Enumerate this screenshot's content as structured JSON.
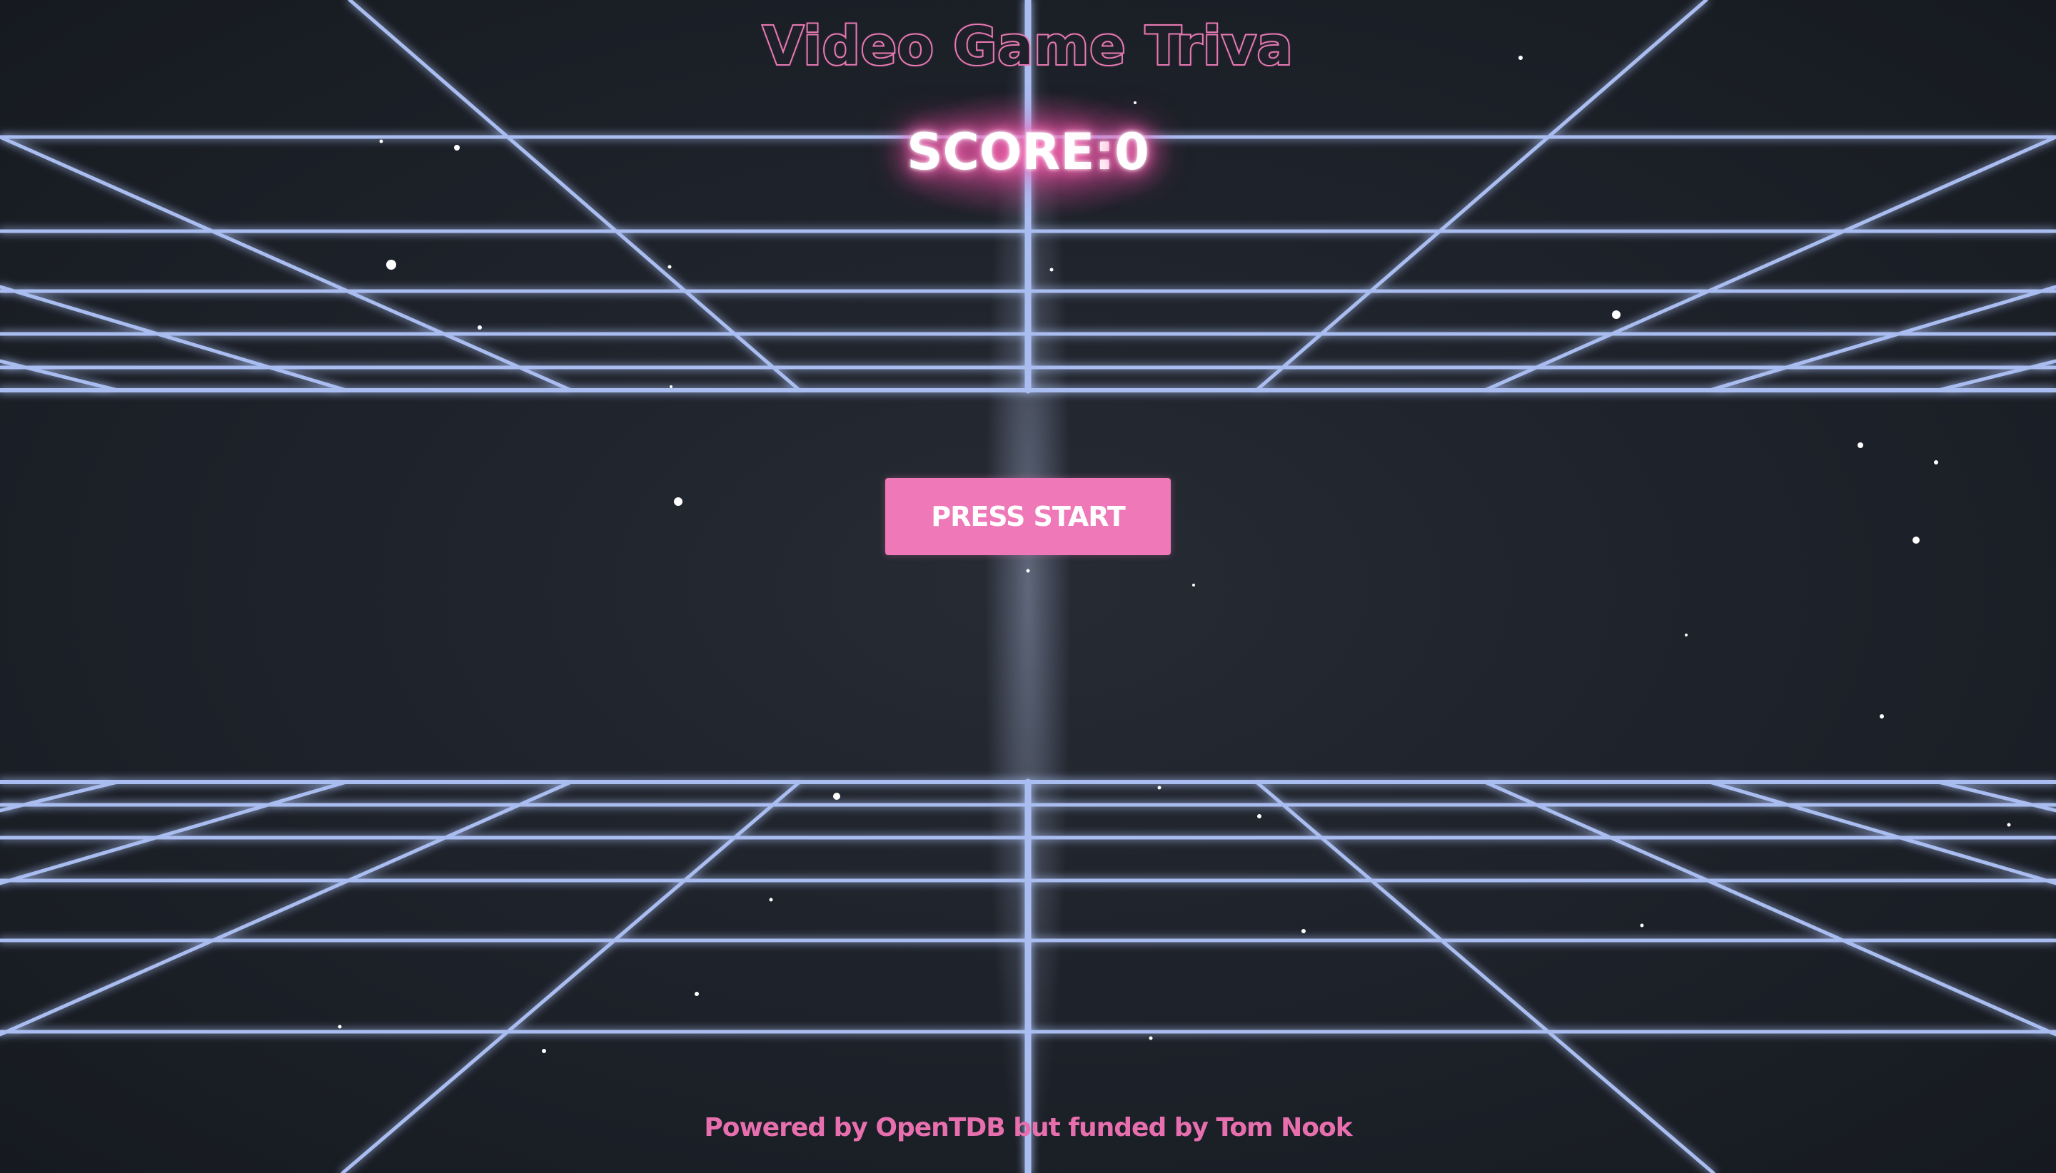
{
  "title": "Video Game Triva",
  "score": {
    "label": "SCORE:",
    "value": "0"
  },
  "start_button": {
    "label": "PRESS START"
  },
  "footer": {
    "text": "Powered by OpenTDB but funded by Tom Nook"
  },
  "colors": {
    "accent_pink": "#ee78b8",
    "grid_line": "#9fb4e8",
    "background": "#1d2129"
  }
}
